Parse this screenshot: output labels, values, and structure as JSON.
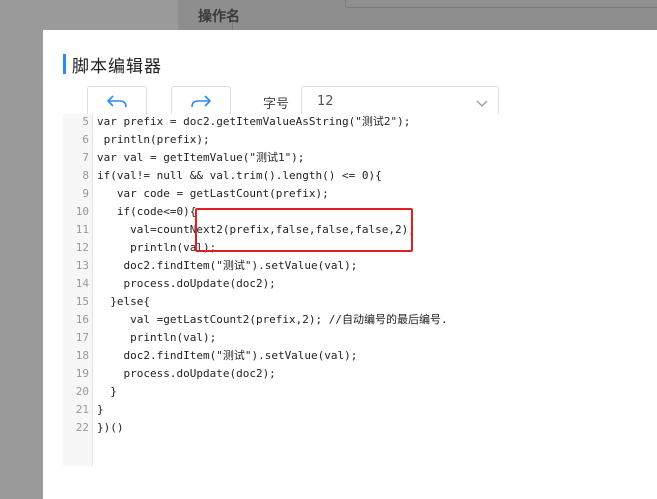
{
  "background": {
    "header_text": "操作名"
  },
  "modal": {
    "title": "脚本编辑器",
    "accent_color": "#2d8cf0",
    "toolbar": {
      "undo_icon": "undo-icon",
      "redo_icon": "redo-icon",
      "font_label": "字号",
      "font_value": "12"
    },
    "editor": {
      "lines": [
        {
          "n": "5",
          "code": "var prefix = doc2.getItemValueAsString(\"测试2\");"
        },
        {
          "n": "6",
          "code": " println(prefix);"
        },
        {
          "n": "7",
          "code": "var val = getItemValue(\"测试1\");"
        },
        {
          "n": "8",
          "code": "if(val!= null && val.trim().length() <= 0){"
        },
        {
          "n": "9",
          "code": "   var code = getLastCount(prefix);"
        },
        {
          "n": "10",
          "code": "   if(code<=0){"
        },
        {
          "n": "11",
          "code": "     val=countNext2(prefix,false,false,false,2);"
        },
        {
          "n": "12",
          "code": "     println(val);"
        },
        {
          "n": "13",
          "code": "    doc2.findItem(\"测试\").setValue(val);"
        },
        {
          "n": "14",
          "code": "    process.doUpdate(doc2);"
        },
        {
          "n": "15",
          "code": "  }else{"
        },
        {
          "n": "16",
          "code": "     val =getLastCount2(prefix,2); //自动编号的最后编号."
        },
        {
          "n": "17",
          "code": "     println(val);"
        },
        {
          "n": "18",
          "code": "    doc2.findItem(\"测试\").setValue(val);"
        },
        {
          "n": "19",
          "code": "    process.doUpdate(doc2);"
        },
        {
          "n": "20",
          "code": "  }"
        },
        {
          "n": "21",
          "code": "}"
        },
        {
          "n": "22",
          "code": "})()"
        }
      ]
    },
    "annotation_color": "#e02020"
  }
}
